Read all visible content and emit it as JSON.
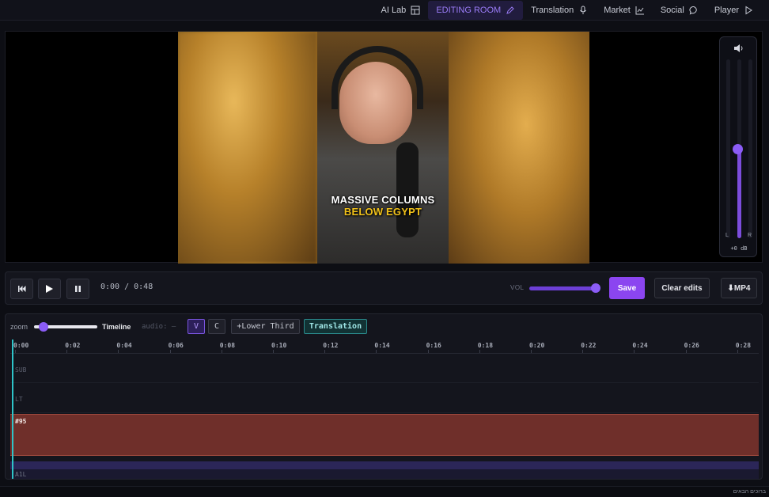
{
  "nav": {
    "items": [
      {
        "label": "AI Lab",
        "icon": "layout-icon"
      },
      {
        "label": "EDITING ROOM",
        "icon": "pencil-icon"
      },
      {
        "label": "Translation",
        "icon": "mic-icon"
      },
      {
        "label": "Market",
        "icon": "chart-icon"
      },
      {
        "label": "Social",
        "icon": "chat-icon"
      },
      {
        "label": "Player",
        "icon": "play-icon"
      }
    ],
    "active": "EDITING ROOM",
    "accent_color": "#8b5cf6"
  },
  "video": {
    "caption_line1": "MASSIVE COLUMNS",
    "caption_line2": "BELOW EGYPT",
    "caption_line2_color": "#f2c21a"
  },
  "volume_meter": {
    "left_label": "L",
    "right_label": "R",
    "db_readout": "+0 dB",
    "level_fraction": 0.5
  },
  "transport": {
    "time_display": "0:00 / 0:48",
    "vol_label": "VOL",
    "volume_fraction": 1.0,
    "save_label": "Save",
    "clear_label": "Clear edits",
    "export_label": "⬇MP4"
  },
  "timeline": {
    "zoom_label": "zoom",
    "title": "Timeline",
    "audio_label": "audio: —",
    "chips": [
      {
        "label": "V",
        "active": true
      },
      {
        "label": "C",
        "active": false
      },
      {
        "label": "+Lower Third",
        "active": false
      },
      {
        "label": "Translation",
        "active": true
      }
    ],
    "ruler_ticks": [
      "0:00",
      "0:02",
      "0:04",
      "0:06",
      "0:08",
      "0:10",
      "0:12",
      "0:14",
      "0:16",
      "0:18",
      "0:20",
      "0:22",
      "0:24",
      "0:26",
      "0:28"
    ],
    "tracks": {
      "sub": "SUB",
      "lt": "LT",
      "clip_label": "#95",
      "a1": "A1L"
    }
  },
  "footer": {
    "text": "ברוכים הבאים"
  }
}
